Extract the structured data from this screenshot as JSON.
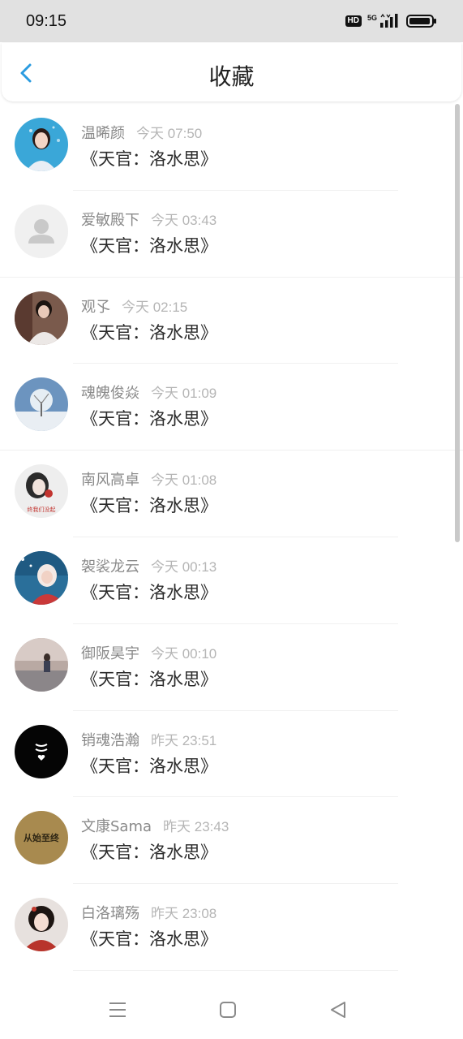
{
  "status_bar": {
    "time": "09:15",
    "hd_badge": "HD",
    "network": "5G",
    "icons": [
      "hd-icon",
      "signal-icon",
      "battery-icon"
    ]
  },
  "header": {
    "title": "收藏",
    "back_icon": "chevron-left-icon",
    "accent_color": "#2a9be0"
  },
  "favorites": [
    {
      "name": "温晞颜",
      "time": "今天 07:50",
      "title": "《天官：洛水思》",
      "avatar": "photo-girl-blue"
    },
    {
      "name": "爱敏殿下",
      "time": "今天 03:43",
      "title": "《天官：洛水思》",
      "avatar": "default-user"
    },
    {
      "name": "观孓",
      "time": "今天 02:15",
      "title": "《天官：洛水思》",
      "avatar": "photo-boy"
    },
    {
      "name": "魂魄俊焱",
      "time": "今天 01:09",
      "title": "《天官：洛水思》",
      "avatar": "photo-winter-tree"
    },
    {
      "name": "南风高卓",
      "time": "今天 01:08",
      "title": "《天官：洛水思》",
      "avatar": "photo-girl-red-text"
    },
    {
      "name": "袈裟龙云",
      "time": "今天 00:13",
      "title": "《天官：洛水思》",
      "avatar": "photo-girl-winter"
    },
    {
      "name": "御阪昊宇",
      "time": "今天 00:10",
      "title": "《天官：洛水思》",
      "avatar": "photo-sky-figure"
    },
    {
      "name": "销魂浩瀚",
      "time": "昨天 23:51",
      "title": "《天官：洛水思》",
      "avatar": "black-emblem"
    },
    {
      "name": "文康Sama",
      "time": "昨天 23:43",
      "title": "《天官：洛水思》",
      "avatar": "text-badge"
    },
    {
      "name": "白洛璃殇",
      "time": "昨天 23:08",
      "title": "《天官：洛水思》",
      "avatar": "photo-ancient-girl"
    }
  ],
  "avatar_texts": {
    "red_text": "终我们没起",
    "badge_text": "从始至终"
  },
  "nav_bar": {
    "buttons": [
      "menu-icon",
      "home-icon",
      "back-icon"
    ]
  }
}
